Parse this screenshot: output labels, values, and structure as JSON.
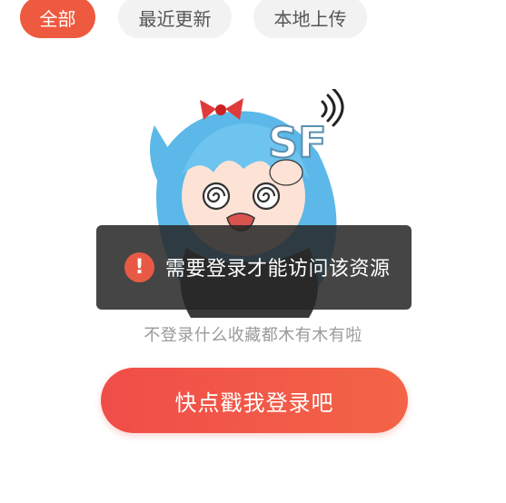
{
  "tabs": {
    "all": "全部",
    "recent": "最近更新",
    "local": "本地上传"
  },
  "mascot": {
    "badge_text": "SF"
  },
  "toast": {
    "icon": "!",
    "message": "需要登录才能访问该资源"
  },
  "empty_hint": "不登录什么收藏都木有木有啦",
  "login_button": "快点戳我登录吧",
  "colors": {
    "accent": "#ee5a3f",
    "tab_bg": "#f2f2f2",
    "toast_bg": "#262626",
    "hair": "#5bb8e8"
  }
}
